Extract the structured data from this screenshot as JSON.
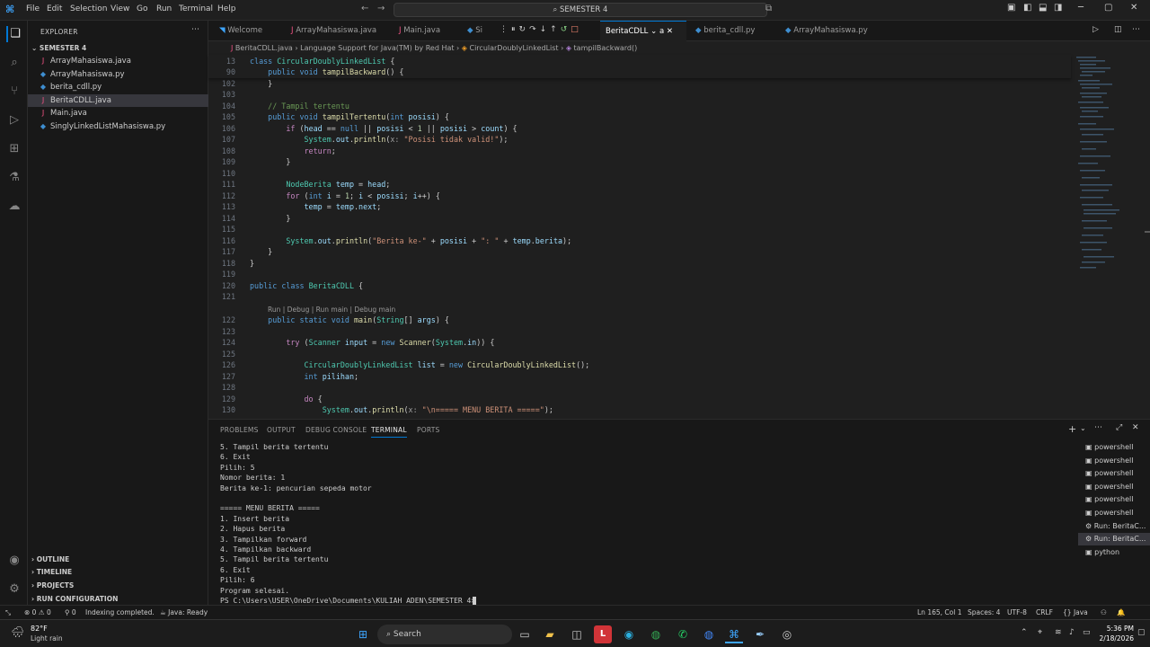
{
  "menu": [
    "File",
    "Edit",
    "Selection",
    "View",
    "Go",
    "Run",
    "Terminal",
    "Help"
  ],
  "command_center": "SEMESTER 4",
  "explorer": {
    "title": "EXPLORER",
    "folder": "SEMESTER 4",
    "files": [
      {
        "name": "ArrayMahasiswa.java",
        "icon": "J",
        "color": "#f55385"
      },
      {
        "name": "ArrayMahasiswa.py",
        "icon": "◆",
        "color": "#3e8ed0"
      },
      {
        "name": "berita_cdll.py",
        "icon": "◆",
        "color": "#3e8ed0"
      },
      {
        "name": "BeritaCDLL.java",
        "icon": "J",
        "color": "#f55385"
      },
      {
        "name": "Main.java",
        "icon": "J",
        "color": "#f55385"
      },
      {
        "name": "SinglyLinkedListMahasiswa.py",
        "icon": "◆",
        "color": "#3e8ed0"
      }
    ],
    "sections": [
      "OUTLINE",
      "TIMELINE",
      "PROJECTS",
      "RUN CONFIGURATION"
    ]
  },
  "tabs": [
    {
      "label": "Welcome",
      "icon": "◥",
      "color": "#3ea6ff"
    },
    {
      "label": "ArrayMahasiswa.java",
      "icon": "J",
      "color": "#f55385"
    },
    {
      "label": "Main.java",
      "icon": "J",
      "color": "#f55385"
    },
    {
      "label": "Si",
      "icon": "◆",
      "color": "#3e8ed0"
    },
    {
      "label": "BeritaCDLL",
      "icon": "J",
      "color": "#f55385"
    },
    {
      "label": "a",
      "icon": "",
      "color": "#cccccc"
    },
    {
      "label": "berita_cdll.py",
      "icon": "◆",
      "color": "#3e8ed0"
    },
    {
      "label": "ArrayMahasiswa.py",
      "icon": "◆",
      "color": "#3e8ed0"
    }
  ],
  "breadcrumb": [
    "BeritaCDLL.java",
    "Language Support for Java(TM) by Red Hat",
    "CircularDoublyLinkedList",
    "tampilBackward()"
  ],
  "code_lens": "Run | Debug | Run main | Debug main",
  "terminal_tabs": [
    "PROBLEMS",
    "OUTPUT",
    "DEBUG CONSOLE",
    "TERMINAL",
    "PORTS"
  ],
  "terminal_lines": [
    "5. Tampil berita tertentu",
    "6. Exit",
    "Pilih: 5",
    "Nomor berita: 1",
    "Berita ke-1: pencurian sepeda motor",
    "",
    "===== MENU BERITA =====",
    "1. Insert berita",
    "2. Hapus berita",
    "3. Tampilkan forward",
    "4. Tampilkan backward",
    "5. Tampil berita tertentu",
    "6. Exit",
    "Pilih: 6",
    "Program selesai.",
    "PS C:\\Users\\USER\\OneDrive\\Documents\\KULIAH ADEN\\SEMESTER 4> "
  ],
  "terminal_list": [
    "powershell",
    "powershell",
    "powershell",
    "powershell",
    "powershell",
    "powershell",
    "Run: BeritaC...",
    "Run: BeritaC...",
    "python"
  ],
  "status": {
    "errors": "0",
    "warnings": "0",
    "ports": "0",
    "indexing": "Indexing completed.",
    "java": "Java: Ready",
    "position": "Ln 165, Col 1",
    "spaces": "Spaces: 4",
    "encoding": "UTF-8",
    "eol": "CRLF",
    "language": "Java"
  },
  "taskbar": {
    "weather_temp": "82°F",
    "weather_desc": "Light rain",
    "search": "Search",
    "time": "5:36 PM",
    "date": "2/18/2026"
  },
  "colors": {
    "accent": "#0078d4",
    "java": "#f55385",
    "python": "#3e8ed0"
  }
}
